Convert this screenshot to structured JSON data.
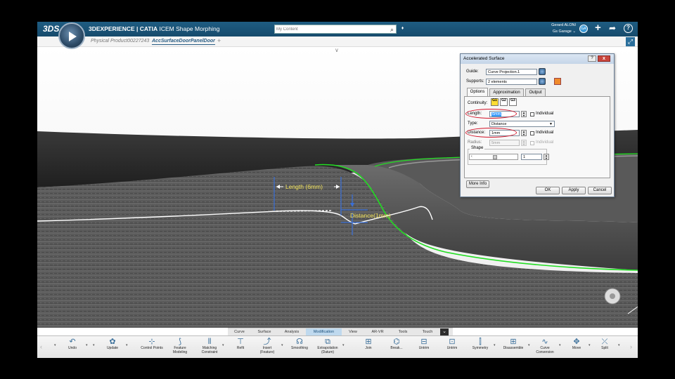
{
  "header": {
    "brand_icon": "3ds-logo",
    "brand_mark": "3DS",
    "compass_icon": "compass-play-icon",
    "title_brand": "3DEXPERIENCE | ",
    "title_product": "CATIA",
    "title_app": " ICEM Shape Morphing",
    "search": {
      "placeholder": "My Content",
      "value": ""
    },
    "user_name": "Gerard ALONI",
    "user_group": "Gs Garage ⌄",
    "avatar_text": "GA"
  },
  "tabs": [
    {
      "label": "Physical Product00227243"
    },
    {
      "label": "AccSurfaceDoorPanelDoor"
    }
  ],
  "viewport": {
    "annotations": {
      "length_label": "Length (6mm)",
      "distance_label": "Distance(1mm)"
    },
    "colors": {
      "edge_highlight": "#22dd22",
      "annotation_text": "#f2e35a",
      "surface": "#6e6e6e"
    }
  },
  "dialog": {
    "title": "Accelerated Surface",
    "guide_label": "Guide:",
    "guide_value": "Curve Projection.1",
    "supports_label": "Supports:",
    "supports_value": "2 elements",
    "tabs": [
      "Options",
      "Approximation",
      "Output"
    ],
    "continuity_label": "Continuity:",
    "continuity_options": [
      "G1",
      "G2",
      "G3"
    ],
    "length_label": "Length:",
    "length_value": "6mm",
    "individual_label": "Individual",
    "type_label": "Type:",
    "type_value": "Distance",
    "distance_label": "Distance:",
    "distance_value": "1mm",
    "radius_label": "Radius:",
    "radius_value": "5mm",
    "shape_label": "Shape",
    "shape_value": "1",
    "more_info": "More Info",
    "ok": "OK",
    "apply": "Apply",
    "cancel": "Cancel",
    "colors": {
      "highlight_ring": "#d3152a",
      "selection": "#3399ff"
    }
  },
  "categories": {
    "items": [
      "Curve",
      "Surface",
      "Analysis",
      "Modification",
      "View",
      "AR-VR",
      "Tools",
      "Touch"
    ],
    "active": "Modification"
  },
  "toolbar": {
    "items": [
      {
        "label": "Undo",
        "icon": "undo-icon",
        "glyph": "↶"
      },
      {
        "label": "Update",
        "icon": "update-icon",
        "glyph": "✿"
      },
      {
        "label": "Control Points",
        "icon": "control-points-icon",
        "glyph": "⊹"
      },
      {
        "label": "Feature Modeling",
        "icon": "feature-modeling-icon",
        "glyph": "⟆"
      },
      {
        "label": "Matching Constraint",
        "icon": "matching-constraint-icon",
        "glyph": "⫴"
      },
      {
        "label": "Refit",
        "icon": "refit-icon",
        "glyph": "⊤"
      },
      {
        "label": "Insert (Feature)",
        "icon": "insert-feature-icon",
        "glyph": "⤴"
      },
      {
        "label": "Smoothing",
        "icon": "smoothing-icon",
        "glyph": "☊"
      },
      {
        "label": "Extrapolation (Datum)",
        "icon": "extrapolation-icon",
        "glyph": "⧉"
      },
      {
        "label": "Join",
        "icon": "join-icon",
        "glyph": "⊞"
      },
      {
        "label": "Break...",
        "icon": "break-icon",
        "glyph": "⌬"
      },
      {
        "label": "Untrim",
        "icon": "untrim-icon",
        "glyph": "⊟"
      },
      {
        "label": "Untrim",
        "icon": "untrim-2-icon",
        "glyph": "⊡"
      },
      {
        "label": "Symmetry",
        "icon": "symmetry-icon",
        "glyph": "⫿"
      },
      {
        "label": "Disassemble",
        "icon": "disassemble-icon",
        "glyph": "⊞"
      },
      {
        "label": "Curve Conversion",
        "icon": "curve-conversion-icon",
        "glyph": "∿"
      },
      {
        "label": "Move",
        "icon": "move-icon",
        "glyph": "✥"
      },
      {
        "label": "Split",
        "icon": "split-icon",
        "glyph": "⤫"
      }
    ]
  }
}
